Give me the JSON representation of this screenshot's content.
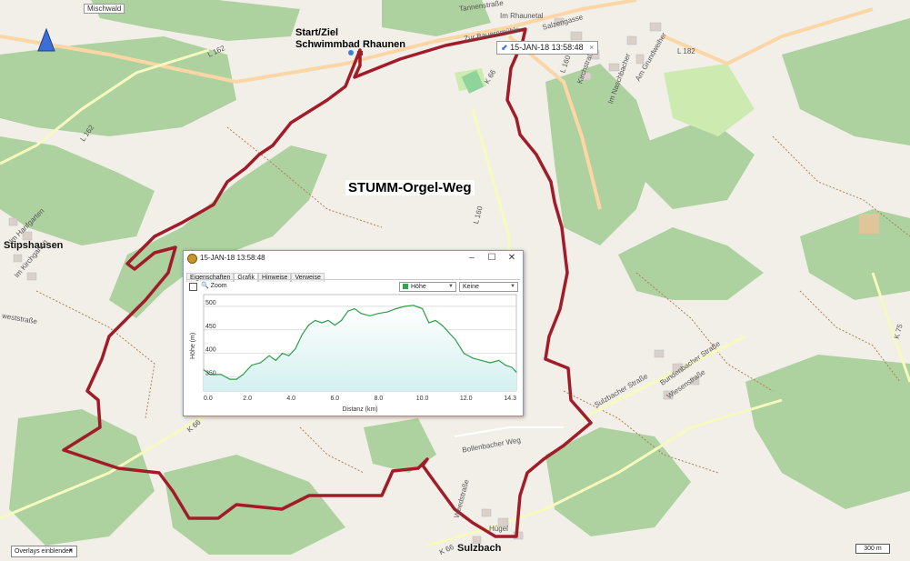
{
  "map": {
    "place_labels": {
      "mischwald": "Mischwald",
      "stipshausen": "Stipshausen",
      "sulzbach": "Sulzbach",
      "start_line1": "Start/Ziel",
      "start_line2": "Schwimmbad Rhaunen",
      "trail_title": "STUMM-Orgel-Weg"
    },
    "road_labels": {
      "l162_a": "L 162",
      "l162_b": "L 162",
      "l160": "L 160",
      "l182": "L 182",
      "l160_b": "L 160",
      "k66_a": "K 66",
      "k66_b": "K 66",
      "k66_c": "K 66",
      "k75": "K 75"
    },
    "street_labels": {
      "tannenstrasse": "Tannenstraße",
      "im_rhaunetal": "Im Rhaunetal",
      "salzengasse": "Salzengasse",
      "zur_bauernmuehle": "Zur Bauernmühle",
      "kirchstrasse": "Kirchstraße",
      "im_naschbacher": "Im Naschbacher",
      "am_grundweiher": "Am Grundweiher",
      "sulzbacher_strasse": "Sulzbacher Straße",
      "bundenbacher_strasse": "Bundenbacher Straße",
      "wiesenstrasse": "Wiesenstraße",
      "bollenbacher_weg": "Bollenbacher Weg",
      "im_hanfgarten": "Im Hanfgarten",
      "im_kirchgarten": "Im Kirchgarten",
      "weststrasse": "weststraße",
      "huegel": "Hügel",
      "weedstrasse": "Weedstraße"
    },
    "waypoint_tooltip": "15-JAN-18 13:58:48",
    "overlays_button": "Overlays einblenden",
    "scale_label": "300 m",
    "colors": {
      "track": "#a01c28",
      "forest": "#aed1a0",
      "land": "#f2efe9",
      "meadow": "#cdebb0"
    },
    "icons": [
      "north-arrow-icon",
      "pin-icon",
      "flag-icon"
    ]
  },
  "graph_window": {
    "title": "15-JAN-18 13:58:48",
    "controls": {
      "minimize": "–",
      "maximize": "☐",
      "close": "✕"
    },
    "tabs": [
      "Eigenschaften",
      "Grafik",
      "Hinweise",
      "Verweise"
    ],
    "active_tab": "Grafik",
    "zoom_label": "Zoom",
    "zoom_checked": false,
    "y_select": "Höhe",
    "overlay_select": "Keine"
  },
  "chart_data": {
    "type": "area",
    "title": "",
    "xlabel": "Distanz  (km)",
    "ylabel": "Höhe (m)",
    "xlim": [
      0,
      14.3
    ],
    "ylim": [
      320,
      525
    ],
    "xticks": [
      "0.0",
      "2.0",
      "4.0",
      "6.0",
      "8.0",
      "10.0",
      "12.0",
      "14.3"
    ],
    "xtick_values": [
      0,
      2,
      4,
      6,
      8,
      10,
      12,
      14.3
    ],
    "yticks": [
      "350",
      "400",
      "450",
      "500"
    ],
    "ytick_values": [
      350,
      400,
      450,
      500
    ],
    "grid": true,
    "line_color": "#2e9e4a",
    "fill_color": "#d4f0f0",
    "series": [
      {
        "x": [
          0,
          0.3,
          0.8,
          1.2,
          1.5,
          1.8,
          2.2,
          2.6,
          3.0,
          3.3,
          3.6,
          3.9,
          4.2,
          4.5,
          4.8,
          5.1,
          5.4,
          5.7,
          6.0,
          6.3,
          6.6,
          6.9,
          7.2,
          7.6,
          8.0,
          8.4,
          8.8,
          9.2,
          9.6,
          10.0,
          10.3,
          10.6,
          10.9,
          11.2,
          11.5,
          11.9,
          12.3,
          12.7,
          13.1,
          13.5,
          13.8,
          14.1,
          14.3
        ],
        "y": [
          365,
          355,
          355,
          345,
          345,
          355,
          375,
          380,
          395,
          385,
          400,
          395,
          410,
          440,
          460,
          470,
          465,
          470,
          460,
          470,
          490,
          495,
          485,
          480,
          485,
          488,
          495,
          500,
          502,
          495,
          465,
          470,
          460,
          445,
          430,
          400,
          390,
          385,
          380,
          385,
          375,
          370,
          360
        ]
      }
    ]
  }
}
